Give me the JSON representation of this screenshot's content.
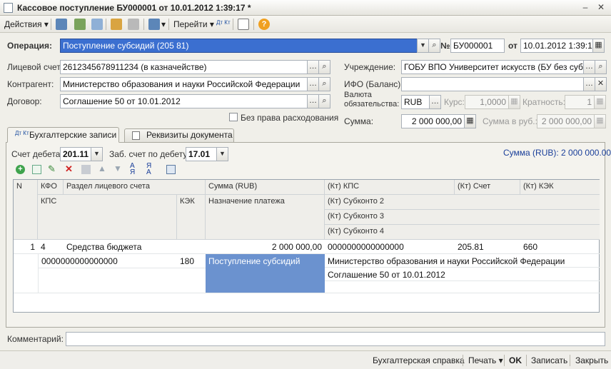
{
  "window": {
    "title": "Кассовое поступление БУ000001 от 10.01.2012 1:39:17 *",
    "minimize": "–",
    "close": "✕"
  },
  "toolbar": {
    "actions": "Действия",
    "goto": "Перейти",
    "help": "?",
    "dt_kt": "Дт Кт"
  },
  "form": {
    "operation_label": "Операция:",
    "operation_value": "Поступление субсидий (205 81)",
    "number_symbol": "№",
    "number_value": "БУ000001",
    "date_label": "от",
    "date_value": "10.01.2012  1:39:17",
    "account_label": "Лицевой счет:",
    "account_value": "2612345678911234   (в казначействе)",
    "institution_label": "Учреждение:",
    "institution_value": "ГОБУ ВПО Университет искусств (БУ без субсид",
    "contractor_label": "Контрагент:",
    "contractor_value": "Министерство образования и науки Российской Федерации",
    "ifo_label": "ИФО (Баланс):",
    "ifo_value": "",
    "contract_label": "Договор:",
    "contract_value": "Соглашение 50 от 10.01.2012",
    "currency_label_1": "Валюта",
    "currency_label_2": "обязательства:",
    "currency_value": "RUB",
    "rate_label": "Курс:",
    "rate_value": "1,0000",
    "multiplicity_label": "Кратность:",
    "multiplicity_value": "1",
    "no_spend_label": "Без права расходования",
    "sum_label": "Сумма:",
    "sum_value": "2 000 000,00",
    "sum_rub_label": "Сумма в руб.:",
    "sum_rub_value": "2 000 000,00",
    "comment_label": "Комментарий:",
    "comment_value": ""
  },
  "tabs": [
    {
      "label": "Бухгалтерские записи",
      "icon": "dt-kt-icon",
      "active": true
    },
    {
      "label": "Реквизиты документа",
      "icon": "document-icon",
      "active": false
    }
  ],
  "entries": {
    "debit_label": "Счет дебета:",
    "debit_value": "201.11",
    "offbal_label": "Заб. счет по дебету:",
    "offbal_value": "17.01",
    "total_label": "Сумма (RUB): 2 000 000.00"
  },
  "grid": {
    "headers": {
      "n": "N",
      "kfo": "КФО",
      "section": "Раздел лицевого счета",
      "sum": "Сумма (RUB)",
      "kt_kps": "(Кт) КПС",
      "kt_account": "(Кт) Счет",
      "kt_kek": "(Кт) КЭК",
      "kps": "КПС",
      "kek": "КЭК",
      "purpose": "Назначение платежа",
      "sub2": "(Кт) Субконто 2",
      "sub3": "(Кт) Субконто 3",
      "sub4": "(Кт) Субконто 4"
    },
    "rows": [
      {
        "n": "1",
        "kfo": "4",
        "section": "Средства бюджета",
        "sum": "2 000 000,00",
        "kt_kps": "0000000000000000",
        "kt_account": "205.81",
        "kt_kek": "660",
        "kps": "0000000000000000",
        "kek": "180",
        "purpose": "Поступление субсидий",
        "sub2": "Министерство образования и науки Российской Федерации",
        "sub3": "Соглашение 50 от 10.01.2012",
        "sub4": ""
      }
    ]
  },
  "footer": {
    "report": "Бухгалтерская справка",
    "print": "Печать",
    "ok": "OK",
    "save": "Записать",
    "close": "Закрыть"
  },
  "colors": {
    "selection": "#3b6fd0",
    "purpose_cell": "#6b92cf",
    "grid_header": "#efeeea",
    "link_blue": "#1a3f9a"
  }
}
